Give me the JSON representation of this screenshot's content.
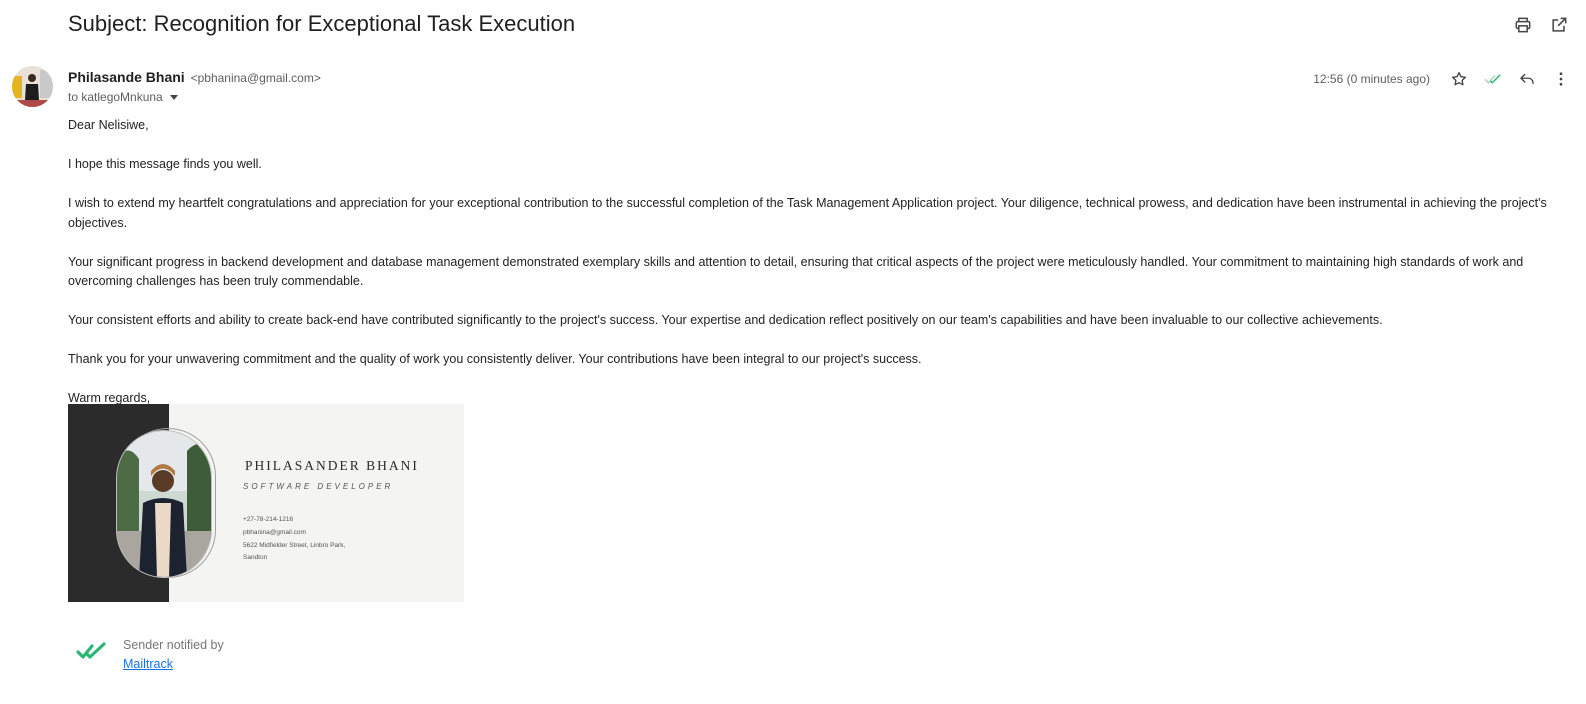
{
  "subject": "Subject: Recognition for Exceptional Task Execution",
  "icons": {
    "print": "print-icon",
    "open_new": "open-in-new-window-icon",
    "star": "star-icon",
    "mailtrack_read": "double-check-icon",
    "reply": "reply-icon",
    "more": "more-vertical-icon",
    "dropdown": "caret-down-icon"
  },
  "sender": {
    "name": "Philasande Bhani",
    "email": "<pbhanina@gmail.com>",
    "to_label": "to katlegoMnkuna"
  },
  "meta": {
    "timestamp": "12:56 (0 minutes ago)"
  },
  "body": {
    "greeting": "Dear Nelisiwe,",
    "p1": "I hope this message finds you well.",
    "p2": "I wish to extend my heartfelt congratulations and appreciation for your exceptional contribution to the successful completion of the Task Management Application project. Your diligence, technical prowess, and dedication have been instrumental in achieving the project's objectives.",
    "p3": "Your significant progress in backend development and database management demonstrated exemplary skills and attention to detail, ensuring that critical aspects of the project were meticulously handled. Your commitment to maintaining high standards of work and overcoming challenges has been truly commendable.",
    "p4": "Your consistent efforts and ability to create back-end have contributed significantly to the project's success. Your expertise and dedication reflect positively on our team's capabilities and have been invaluable to our collective achievements.",
    "p5": "Thank you for your unwavering commitment and the quality of work you consistently deliver. Your contributions have been integral to our project's success.",
    "closing": "Warm regards,"
  },
  "signature": {
    "name": "PHILASANDER BHANI",
    "role": "SOFTWARE DEVELOPER",
    "phone": "+27-78-214-1216",
    "email": "pbhanina@gmail.com",
    "address_line1": "5622 Midfielder Street, Linbro Park,",
    "address_line2": "Sandton"
  },
  "mailtrack": {
    "text": "Sender notified by",
    "link": "Mailtrack"
  },
  "colors": {
    "mailtrack_green": "#2bb673",
    "link_blue": "#1a73e8",
    "signature_dark": "#2b2b2b"
  }
}
